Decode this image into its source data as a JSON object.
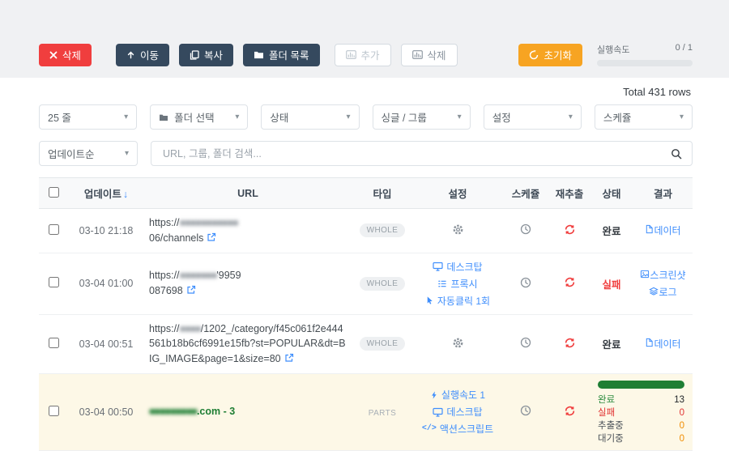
{
  "toolbar": {
    "delete_label": "삭제",
    "move_label": "이동",
    "copy_label": "복사",
    "folder_list_label": "폴더 목록",
    "add_label": "추가",
    "chart_delete_label": "삭제",
    "reset_label": "초기화",
    "speed_label": "실행속도",
    "speed_value": "0 / 1"
  },
  "summary": {
    "total": "Total 431 rows"
  },
  "filters": {
    "page_size": "25 줄",
    "folder": "폴더 선택",
    "status": "상태",
    "single_group": "싱글 / 그룹",
    "settings": "설정",
    "schedule": "스케쥴",
    "sort": "업데이트순",
    "search_placeholder": "URL, 그룹, 폴더 검색..."
  },
  "table": {
    "headers": {
      "update": "업데이트",
      "url": "URL",
      "type": "타입",
      "settings": "설정",
      "schedule": "스케쥴",
      "reextract": "재추출",
      "status": "상태",
      "result": "결과"
    },
    "rows": [
      {
        "date": "03-10 21:18",
        "url_prefix": "https://",
        "url_redacted": "■■■■■■■■■■■",
        "url_visible": "06/channels",
        "type": "WHOLE",
        "status": "완료",
        "result": "데이터"
      },
      {
        "date": "03-04 01:00",
        "url_prefix": "https://",
        "url_redacted": "■■■■■■■",
        "url_visible": "'9959",
        "url_visible2": "087698",
        "type": "WHOLE",
        "settings": [
          {
            "label": "데스크탑"
          },
          {
            "label": "프록시"
          },
          {
            "label": "자동클릭 1회"
          }
        ],
        "status": "실패",
        "results": {
          "screenshot": "스크린샷",
          "log": "로그"
        }
      },
      {
        "date": "03-04 00:51",
        "url_prefix": "https://",
        "url_redacted": "■■■■",
        "url_visible": "/1202_/category/f45c061f2e444561b18b6cf6991e15fb?st=POPULAR&dt=BIG_IMAGE&page=1&size=80",
        "type": "WHOLE",
        "status": "완료",
        "result": "데이터"
      },
      {
        "date": "03-04 00:50",
        "url_redacted": "■■■■■■■■■",
        "url_visible": ".com - 3",
        "type": "PARTS",
        "settings": [
          {
            "label": "실행속도 1"
          },
          {
            "label": "데스크탑"
          },
          {
            "label": "액션스크립트"
          }
        ],
        "stats": [
          {
            "label": "완료",
            "value": "13"
          },
          {
            "label": "실패",
            "value": "0"
          },
          {
            "label": "추출중",
            "value": "0"
          },
          {
            "label": "대기중",
            "value": "0"
          }
        ]
      }
    ]
  },
  "colors": {
    "accent_red": "#f03e3e",
    "navy": "#35495e",
    "orange": "#f7a422",
    "link_blue": "#3f8efc",
    "green": "#1e7e34",
    "row_highlight": "#fdf8e7"
  }
}
